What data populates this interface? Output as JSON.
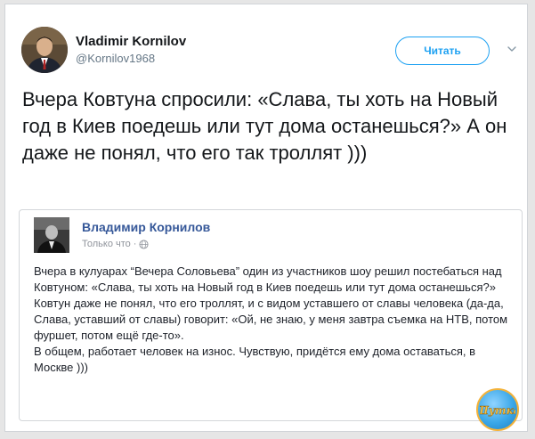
{
  "tweet": {
    "author_name": "Vladimir Kornilov",
    "author_handle": "@Kornilov1968",
    "follow_label": "Читать",
    "text": "Вчера Ковтуна спросили: «Слава, ты хоть на Новый год в Киев поедешь или тут дома останешься?» А он даже не понял, что его так троллят )))"
  },
  "embed": {
    "author_name": "Владимир Корнилов",
    "time": "Только что",
    "time_separator": "·",
    "body_paragraphs": [
      "Вчера в кулуарах “Вечера Соловьева” один из участников шоу решил постебаться над Ковтуном: «Слава, ты хоть на Новый год в Киев поедешь или тут дома останешься?» Ковтун даже не понял, что его троллят, и с видом уставшего от славы человека (да-да, Слава, уставший от славы) говорит: «Ой, не знаю, у меня завтра съемка на НТВ, потом фуршет, потом ещё где-то».",
      "В общем, работает человек на износ. Чувствую, придётся  ему дома оставаться, в Москве )))"
    ]
  },
  "watermark": {
    "text": "Шутка"
  },
  "colors": {
    "accent": "#1da1f2",
    "fb_link": "#365899",
    "text": "#14171a",
    "muted": "#657786"
  },
  "icons": [
    "avatar",
    "chevron-down-icon",
    "globe-icon",
    "watermark-logo"
  ]
}
